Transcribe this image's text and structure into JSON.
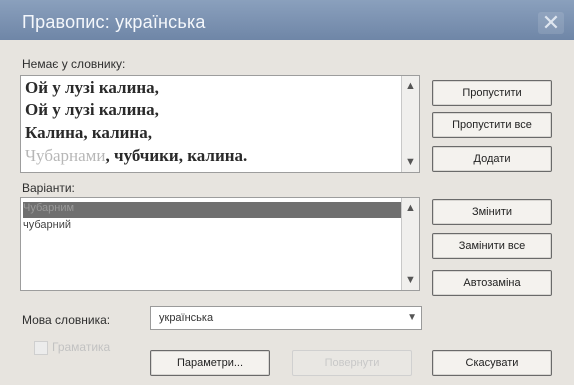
{
  "window": {
    "title": "Правопис: українська",
    "close_glyph": "✕"
  },
  "not_in_dictionary": {
    "label": "Немає у словнику:",
    "lines": [
      "Ой у лузі калина,",
      "Ой у лузі калина,",
      "Калина, калина,"
    ],
    "last_line_faded": "Чубарнами",
    "last_line_rest": ", чубчики, калина."
  },
  "suggestions": {
    "label": "Варіанти:",
    "items": [
      "Чубарним",
      "чубарний"
    ]
  },
  "buttons": {
    "skip": "Пропустити",
    "skip_all": "Пропустити все",
    "add": "Додати",
    "change": "Змінити",
    "change_all": "Замінити все",
    "autocorrect": "Автозаміна",
    "options": "Параметри...",
    "undo": "Повернути",
    "cancel": "Скасувати"
  },
  "dictionary_language": {
    "label": "Мова словника:",
    "value": "українська"
  },
  "grammar_check": {
    "label": "Граматика"
  }
}
